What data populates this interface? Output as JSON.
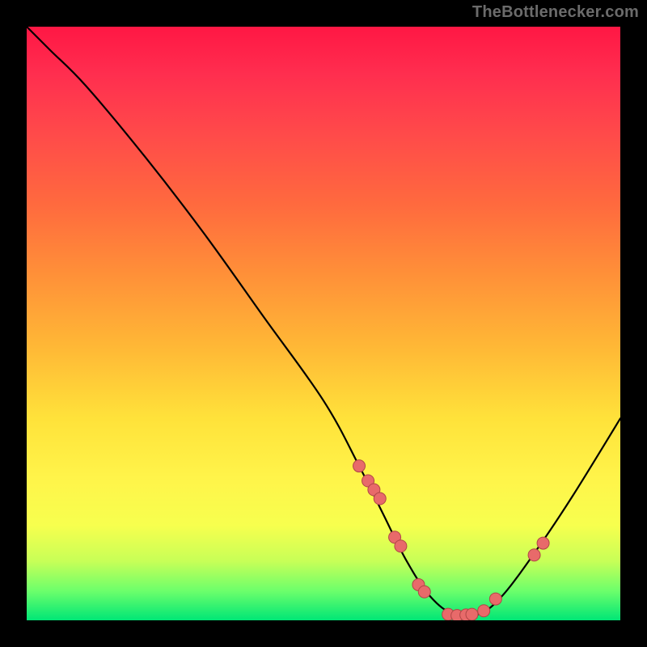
{
  "attribution": "TheBottlenecker.com",
  "chart_data": {
    "type": "line",
    "title": "",
    "xlabel": "",
    "ylabel": "",
    "xlim": [
      0,
      100
    ],
    "ylim": [
      0,
      100
    ],
    "series": [
      {
        "name": "bottleneck-curve",
        "x": [
          0,
          4,
          10,
          20,
          30,
          40,
          50,
          56,
          60,
          64,
          68,
          72,
          76,
          80,
          86,
          92,
          100
        ],
        "y": [
          100,
          96,
          90,
          78,
          65,
          51,
          37,
          26,
          18,
          10,
          4,
          1,
          1,
          4,
          12,
          21,
          34
        ]
      }
    ],
    "markers": {
      "name": "highlight-points",
      "x": [
        56.0,
        57.5,
        58.5,
        59.5,
        62.0,
        63.0,
        66.0,
        67.0,
        71.0,
        72.5,
        74.0,
        75.0,
        77.0,
        79.0,
        85.5,
        87.0
      ],
      "y": [
        26.0,
        23.5,
        22.0,
        20.5,
        14.0,
        12.5,
        6.0,
        4.8,
        1.0,
        0.8,
        0.9,
        1.0,
        1.6,
        3.6,
        11.0,
        13.0
      ]
    },
    "gradient_stops": [
      {
        "pos": 0.0,
        "color": "#ff1744"
      },
      {
        "pos": 0.3,
        "color": "#ff6a3e"
      },
      {
        "pos": 0.66,
        "color": "#ffe23a"
      },
      {
        "pos": 0.9,
        "color": "#c8ff57"
      },
      {
        "pos": 1.0,
        "color": "#00e676"
      }
    ]
  }
}
